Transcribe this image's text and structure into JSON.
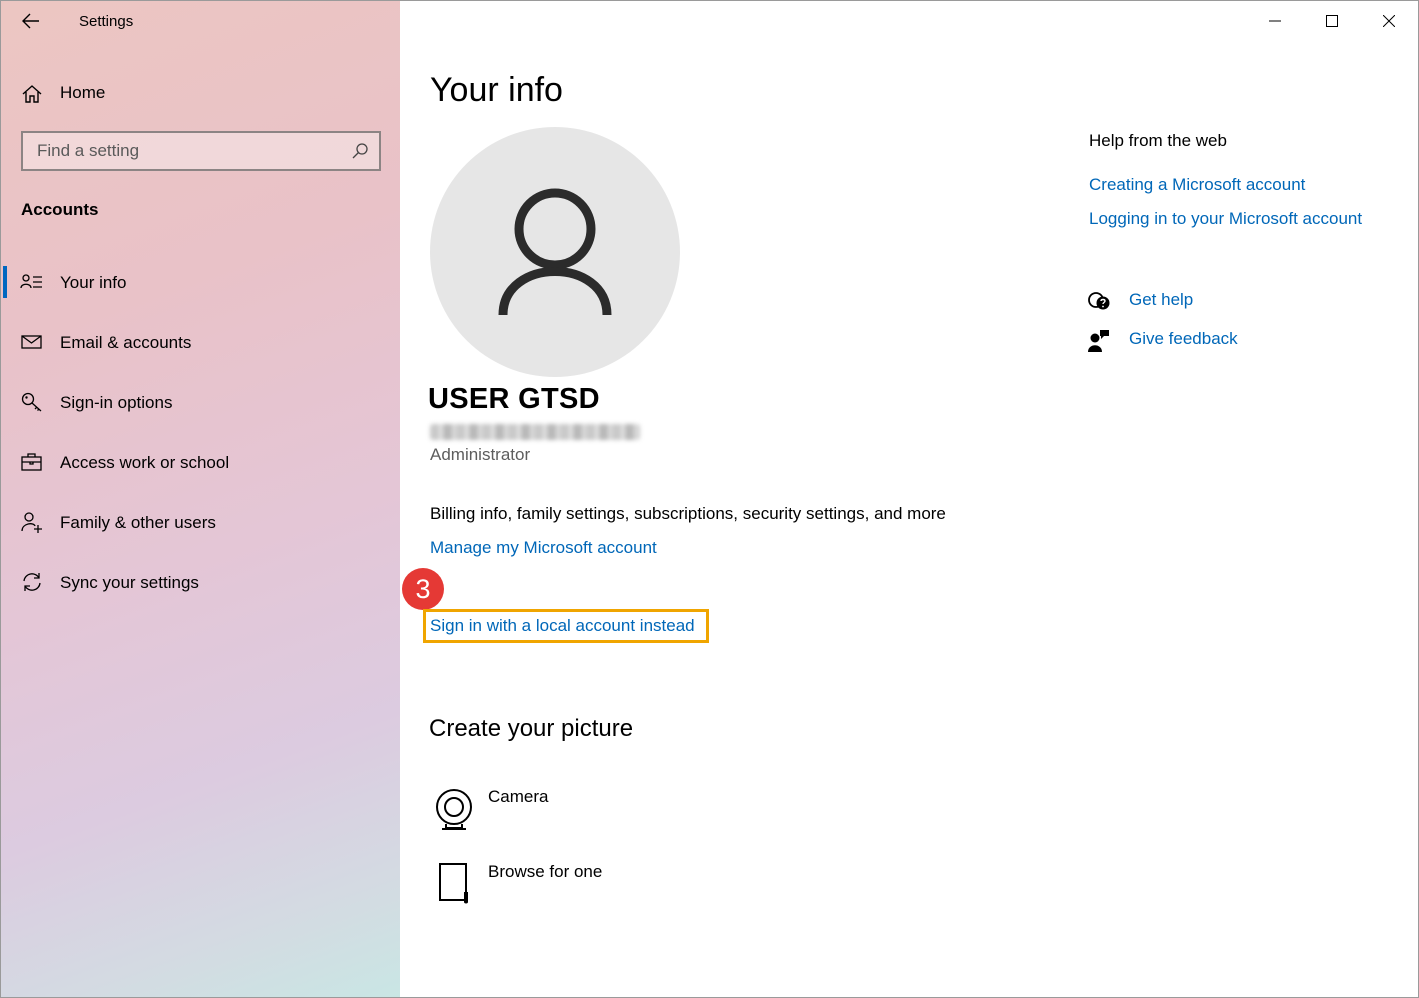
{
  "app": {
    "title": "Settings"
  },
  "sidebar": {
    "home_label": "Home",
    "search_placeholder": "Find a setting",
    "section_label": "Accounts",
    "items": [
      {
        "label": "Your info",
        "icon": "contact-info-icon",
        "active": true
      },
      {
        "label": "Email & accounts",
        "icon": "mail-icon"
      },
      {
        "label": "Sign-in options",
        "icon": "key-icon"
      },
      {
        "label": "Access work or school",
        "icon": "briefcase-icon"
      },
      {
        "label": "Family & other users",
        "icon": "add-person-icon"
      },
      {
        "label": "Sync your settings",
        "icon": "sync-icon"
      }
    ]
  },
  "main": {
    "page_title": "Your info",
    "user_name": "USER GTSD",
    "role": "Administrator",
    "billing_text": "Billing info, family settings, subscriptions, security settings, and more",
    "manage_link": "Manage my Microsoft account",
    "step_badge": "3",
    "local_account_link": "Sign in with a local account instead",
    "create_picture_title": "Create your picture",
    "picture_options": [
      {
        "label": "Camera",
        "icon": "webcam-icon"
      },
      {
        "label": "Browse for one",
        "icon": "document-icon"
      }
    ]
  },
  "help": {
    "title": "Help from the web",
    "links": [
      "Creating a Microsoft account",
      "Logging in to your Microsoft account"
    ],
    "get_help": "Get help",
    "give_feedback": "Give feedback"
  },
  "colors": {
    "link": "#0067b8",
    "accent": "#0067c0",
    "highlight": "#f0a500",
    "badge": "#e53935"
  }
}
